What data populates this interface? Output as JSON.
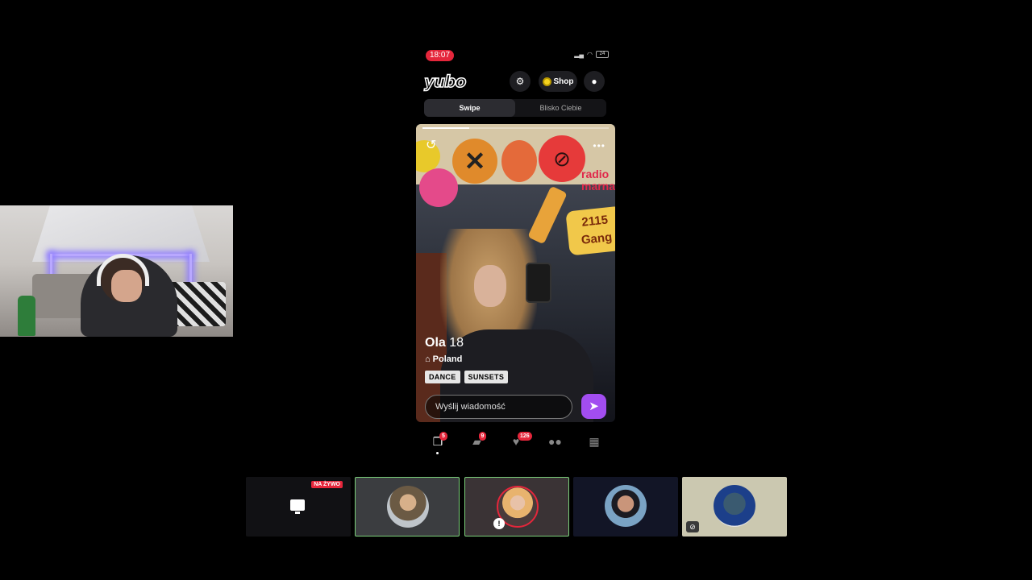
{
  "webcam": {
    "label": "streamer webcam"
  },
  "status_bar": {
    "time": "18:07",
    "battery": "24"
  },
  "app": {
    "logo": "yubo",
    "shop_label": "Shop",
    "tabs": [
      {
        "label": "Swipe",
        "active": true
      },
      {
        "label": "Blisko Ciebie",
        "active": false
      }
    ]
  },
  "profile": {
    "name": "Ola",
    "age": "18",
    "country": "Poland",
    "tags": [
      "DANCE",
      "SUNSETS"
    ],
    "photo_progress": 0.25,
    "sticker_texts": {
      "gang_number": "2115",
      "gang_word": "Gang",
      "radio": "radio marna"
    }
  },
  "message": {
    "placeholder": "Wyślij wiadomość"
  },
  "nav": {
    "items": [
      {
        "icon": "swipe-cards-icon",
        "badge": "5",
        "active": true
      },
      {
        "icon": "chat-icon",
        "badge": "9",
        "active": false
      },
      {
        "icon": "heart-icon",
        "badge": "126",
        "active": false
      },
      {
        "icon": "friends-icon",
        "badge": "",
        "active": false
      },
      {
        "icon": "grid-icon",
        "badge": "",
        "active": false
      }
    ]
  },
  "participants": {
    "live_badge": "NA ŻYWO",
    "tiles": [
      {
        "kind": "screen-share",
        "speaking": false
      },
      {
        "kind": "avatar",
        "speaking": true
      },
      {
        "kind": "avatar",
        "speaking": true,
        "muted": true
      },
      {
        "kind": "avatar",
        "speaking": false
      },
      {
        "kind": "avatar",
        "speaking": false,
        "camera_off": true
      }
    ]
  },
  "colors": {
    "accent_red": "#e5263b",
    "send_purple": "#a24df0",
    "speaking_green": "#7bd07a"
  }
}
